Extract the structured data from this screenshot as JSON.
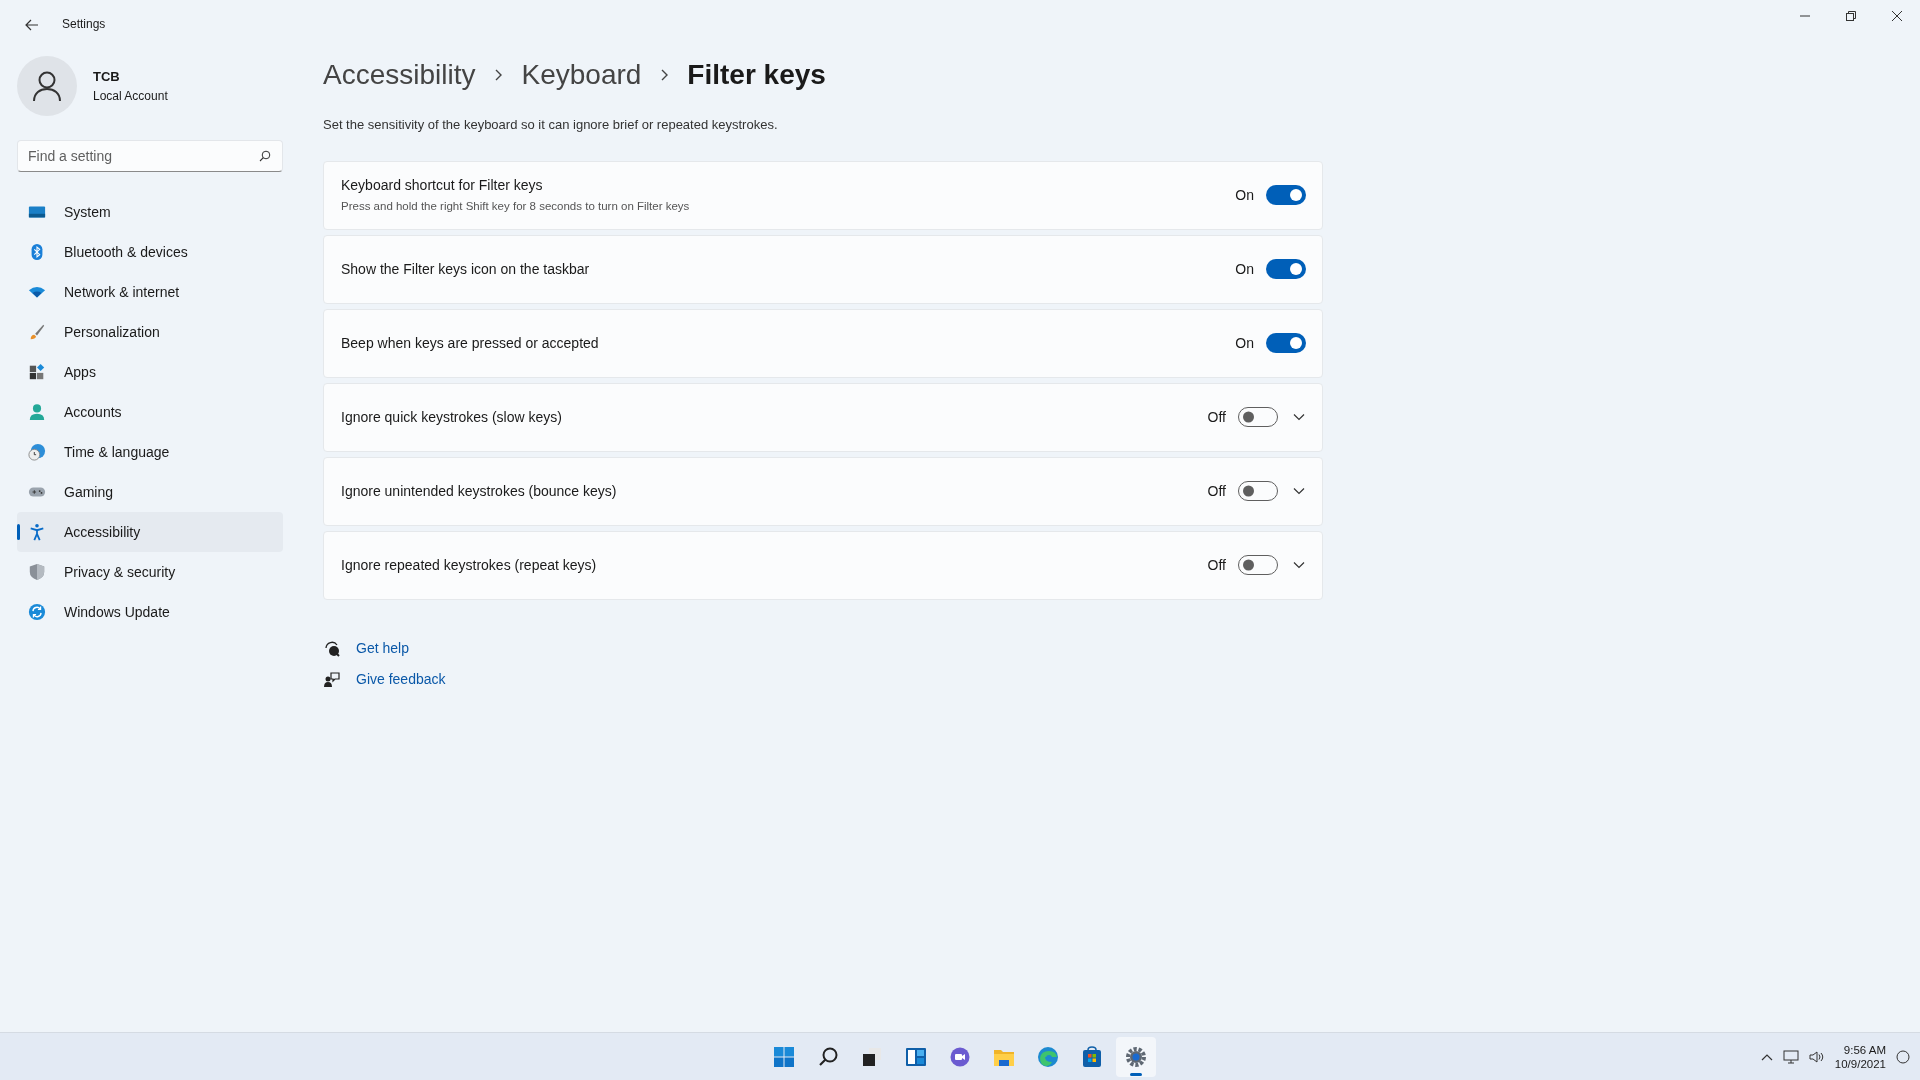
{
  "window": {
    "title": "Settings"
  },
  "account": {
    "name": "TCB",
    "type": "Local Account"
  },
  "search": {
    "placeholder": "Find a setting"
  },
  "nav": [
    {
      "label": "System",
      "selected": false
    },
    {
      "label": "Bluetooth & devices",
      "selected": false
    },
    {
      "label": "Network & internet",
      "selected": false
    },
    {
      "label": "Personalization",
      "selected": false
    },
    {
      "label": "Apps",
      "selected": false
    },
    {
      "label": "Accounts",
      "selected": false
    },
    {
      "label": "Time & language",
      "selected": false
    },
    {
      "label": "Gaming",
      "selected": false
    },
    {
      "label": "Accessibility",
      "selected": true
    },
    {
      "label": "Privacy & security",
      "selected": false
    },
    {
      "label": "Windows Update",
      "selected": false
    }
  ],
  "breadcrumb": [
    "Accessibility",
    "Keyboard",
    "Filter keys"
  ],
  "description": "Set the sensitivity of the keyboard so it can ignore brief or repeated keystrokes.",
  "settings": [
    {
      "title": "Keyboard shortcut for Filter keys",
      "subtitle": "Press and hold the right Shift key for 8 seconds to turn on Filter keys",
      "state_label": "On",
      "on": true,
      "expandable": false
    },
    {
      "title": "Show the Filter keys icon on the taskbar",
      "state_label": "On",
      "on": true,
      "expandable": false
    },
    {
      "title": "Beep when keys are pressed or accepted",
      "state_label": "On",
      "on": true,
      "expandable": false
    },
    {
      "title": "Ignore quick keystrokes (slow keys)",
      "state_label": "Off",
      "on": false,
      "expandable": true
    },
    {
      "title": "Ignore unintended keystrokes (bounce keys)",
      "state_label": "Off",
      "on": false,
      "expandable": true
    },
    {
      "title": "Ignore repeated keystrokes (repeat keys)",
      "state_label": "Off",
      "on": false,
      "expandable": true
    }
  ],
  "links": [
    {
      "label": "Get help"
    },
    {
      "label": "Give feedback"
    }
  ],
  "taskbar": {
    "apps": [
      {
        "selected": false
      },
      {
        "selected": false
      },
      {
        "selected": false
      },
      {
        "selected": false
      },
      {
        "selected": false
      },
      {
        "selected": false
      },
      {
        "selected": false
      },
      {
        "selected": false
      },
      {
        "selected": true
      }
    ],
    "time": "9:56 AM",
    "date": "10/9/2021"
  }
}
